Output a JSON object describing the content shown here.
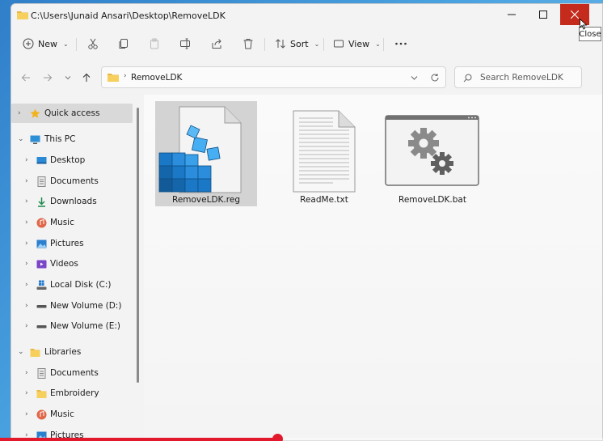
{
  "window": {
    "title": "C:\\Users\\Junaid Ansari\\Desktop\\RemoveLDK"
  },
  "tooltip": {
    "text": "Close"
  },
  "toolbar": {
    "new_label": "New",
    "sort_label": "Sort",
    "view_label": "View"
  },
  "address": {
    "folder": "RemoveLDK"
  },
  "search": {
    "placeholder": "Search RemoveLDK"
  },
  "sidebar": {
    "items": [
      {
        "label": "Quick access"
      },
      {
        "label": "This PC"
      },
      {
        "label": "Desktop"
      },
      {
        "label": "Documents"
      },
      {
        "label": "Downloads"
      },
      {
        "label": "Music"
      },
      {
        "label": "Pictures"
      },
      {
        "label": "Videos"
      },
      {
        "label": "Local Disk (C:)"
      },
      {
        "label": "New Volume (D:)"
      },
      {
        "label": "New Volume (E:)"
      },
      {
        "label": "Libraries"
      },
      {
        "label": "Documents"
      },
      {
        "label": "Embroidery"
      },
      {
        "label": "Music"
      },
      {
        "label": "Pictures"
      }
    ]
  },
  "files": [
    {
      "name": "RemoveLDK.reg",
      "icon": "registry-icon"
    },
    {
      "name": "ReadMe.txt",
      "icon": "text-file-icon"
    },
    {
      "name": "RemoveLDK.bat",
      "icon": "batch-file-icon"
    }
  ],
  "video": {
    "progress": 0.46
  },
  "colors": {
    "close": "#c42b1c",
    "accent": "#0067c0",
    "progress": "#e2192c"
  }
}
